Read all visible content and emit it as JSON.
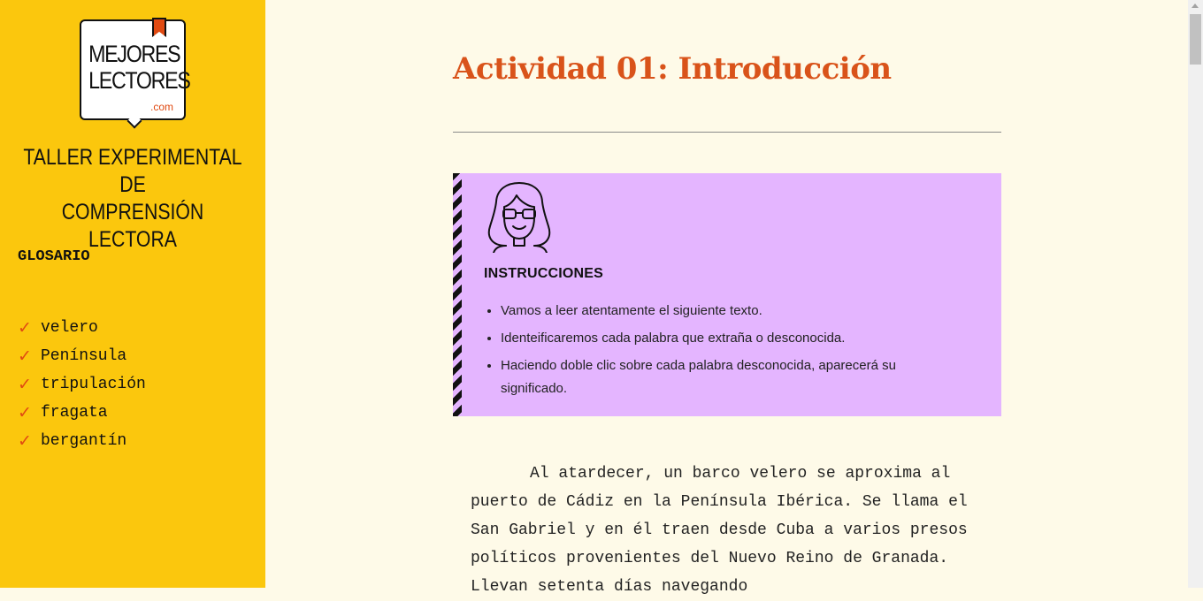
{
  "logo": {
    "line1": "MEJORES",
    "line2": "LECTORES",
    "dotcom": ".com"
  },
  "sidebar": {
    "subtitle_line1": "TALLER EXPERIMENTAL DE",
    "subtitle_line2": "COMPRENSIÓN LECTORA",
    "glossary_title": "GLOSARIO",
    "check_glyph": "✓",
    "glossary": [
      {
        "term": "velero"
      },
      {
        "term": "Península"
      },
      {
        "term": "tripulación"
      },
      {
        "term": "fragata"
      },
      {
        "term": "bergantín"
      }
    ]
  },
  "main": {
    "title": "Actividad 01: Introducción",
    "instructions": {
      "heading": "INSTRUCCIONES",
      "items": [
        "Vamos a leer atentamente el siguiente texto.",
        "Identeificaremos cada palabra que extraña o desconocida.",
        "Haciendo doble clic sobre cada palabra desconocida, aparecerá su significado."
      ]
    },
    "story": "Al atardecer, un barco velero se aproxima al puerto de Cádiz en la Península Ibérica. Se llama el San Gabriel y en él traen desde Cuba a varios presos políticos provenientes del Nuevo Reino de Granada. Llevan setenta días navegando"
  },
  "colors": {
    "sidebar_bg": "#fbc70d",
    "page_bg": "#fefae8",
    "accent": "#d9531a",
    "instructions_bg": "#e4b5ff"
  },
  "icons": [
    "bookmark-icon",
    "checkmark-icon",
    "reader-avatar-icon"
  ]
}
